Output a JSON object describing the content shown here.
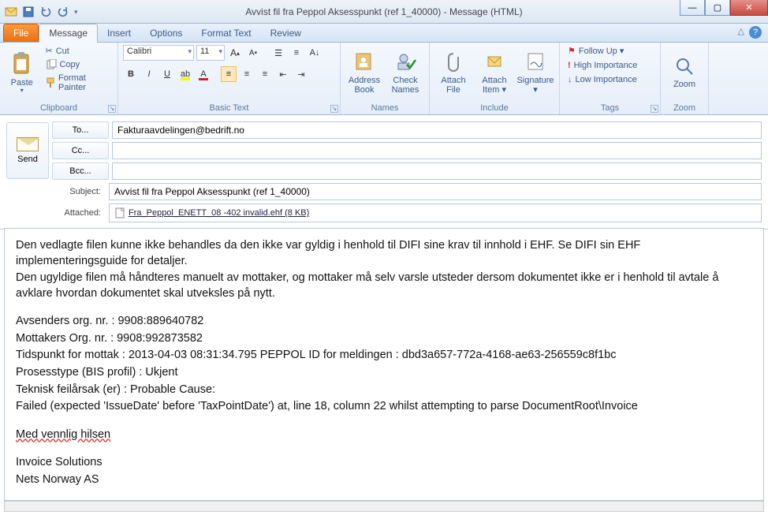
{
  "window": {
    "title": "Avvist fil fra Peppol Aksesspunkt (ref 1_40000)  -  Message (HTML)"
  },
  "qat": {
    "items": [
      "save",
      "undo",
      "redo",
      "prev",
      "next"
    ]
  },
  "tabs": {
    "file": "File",
    "items": [
      "Message",
      "Insert",
      "Options",
      "Format Text",
      "Review"
    ],
    "active": "Message"
  },
  "ribbon": {
    "clipboard": {
      "label": "Clipboard",
      "paste": "Paste",
      "cut": "Cut",
      "copy": "Copy",
      "format_painter": "Format Painter"
    },
    "basic_text": {
      "label": "Basic Text",
      "font": "Calibri",
      "size": "11"
    },
    "names": {
      "label": "Names",
      "address_book": "Address\nBook",
      "check_names": "Check\nNames"
    },
    "include": {
      "label": "Include",
      "attach_file": "Attach\nFile",
      "attach_item": "Attach\nItem ▾",
      "signature": "Signature\n▾"
    },
    "tags": {
      "label": "Tags",
      "follow_up": "Follow Up ▾",
      "high": "High Importance",
      "low": "Low Importance"
    },
    "zoom": {
      "label": "Zoom",
      "zoom": "Zoom"
    }
  },
  "header": {
    "send": "Send",
    "to_btn": "To...",
    "cc_btn": "Cc...",
    "bcc_btn": "Bcc...",
    "subject_label": "Subject:",
    "attached_label": "Attached:",
    "to_value": "Fakturaavdelingen@bedrift.no",
    "cc_value": "",
    "bcc_value": "",
    "subject_value": "Avvist fil fra Peppol Aksesspunkt (ref 1_40000)",
    "attachment": "Fra_Peppol_ENETT_08 -402 invalid.ehf (8 KB)"
  },
  "body": {
    "p1": "Den vedlagte filen kunne ikke behandles da den ikke var gyldig i henhold til DIFI sine krav til innhold i EHF. Se DIFI sin EHF implementeringsguide for detaljer.",
    "p2": "Den ugyldige filen må håndteres manuelt av mottaker, og mottaker må selv varsle utsteder dersom dokumentet ikke er i henhold til avtale å avklare hvordan dokumentet skal utveksles på nytt.",
    "l1": "Avsenders org. nr. : 9908:889640782",
    "l2": "Mottakers Org. nr. : 9908:992873582",
    "l3": "Tidspunkt for mottak :  2013-04-03 08:31:34.795  PEPPOL ID for meldingen : dbd3a657-772a-4168-ae63-256559c8f1bc",
    "l4": "Prosesstype (BIS profil) :  Ukjent",
    "l5": "Teknisk feilårsak (er) : Probable Cause:",
    "l6": "Failed (expected 'IssueDate' before 'TaxPointDate') at, line 18, column 22 whilst attempting to parse DocumentRoot\\Invoice",
    "sign1": "Med vennlig hilsen",
    "sign2": "Invoice Solutions",
    "sign3": "Nets Norway AS"
  }
}
